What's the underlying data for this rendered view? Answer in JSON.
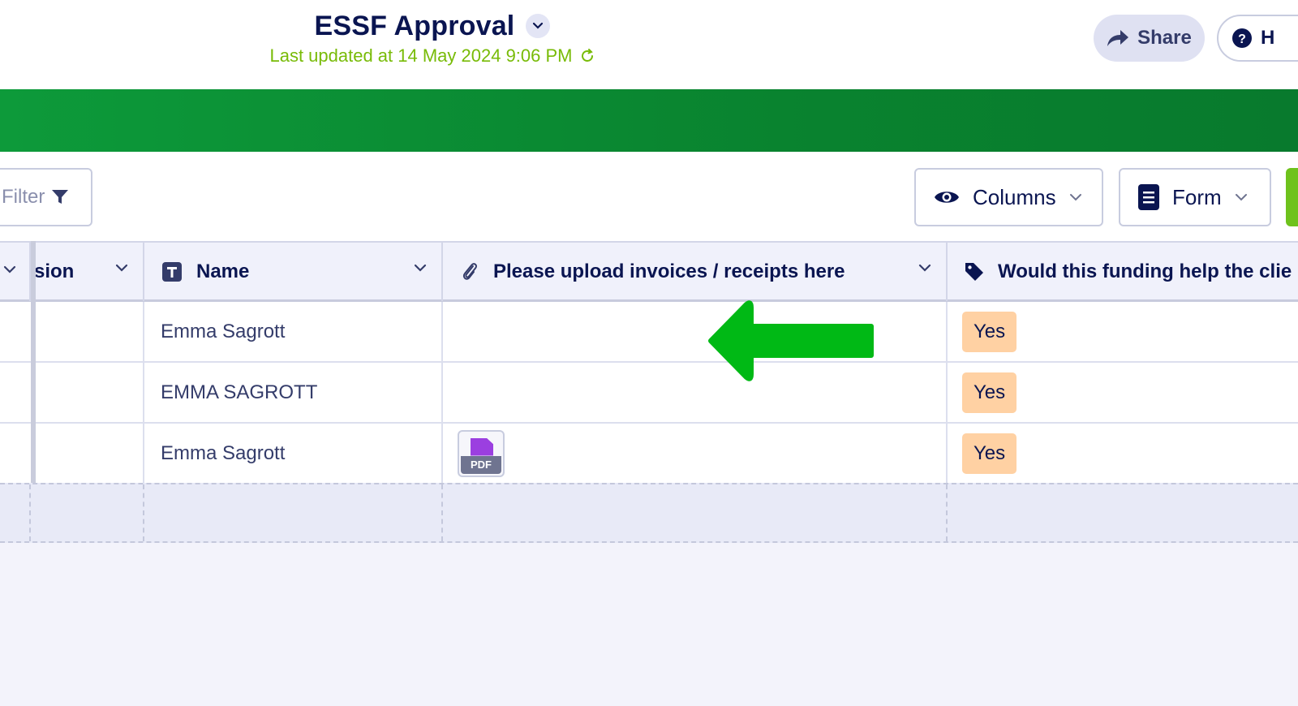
{
  "header": {
    "title": "ESSF Approval",
    "subtitle": "Last updated at 14 May 2024 9:06 PM",
    "share_label": "Share",
    "help_label": "H"
  },
  "toolbar": {
    "filter_label": "Filter",
    "columns_label": "Columns",
    "form_label": "Form"
  },
  "table": {
    "columns": [
      "sion",
      "Name",
      "Please upload invoices / receipts here",
      "Would this funding help the clie"
    ],
    "rows": [
      {
        "name": "Emma Sagrott",
        "attachment": "",
        "funding": "Yes"
      },
      {
        "name": "EMMA SAGROTT",
        "attachment": "",
        "funding": "Yes"
      },
      {
        "name": "Emma Sagrott",
        "attachment": "PDF",
        "funding": "Yes"
      }
    ]
  },
  "colors": {
    "accent_green": "#09832f",
    "subtitle_green": "#78bb07",
    "arrow_green": "#00b915",
    "yes_badge": "#ffd1a3",
    "navy": "#0a1551"
  }
}
